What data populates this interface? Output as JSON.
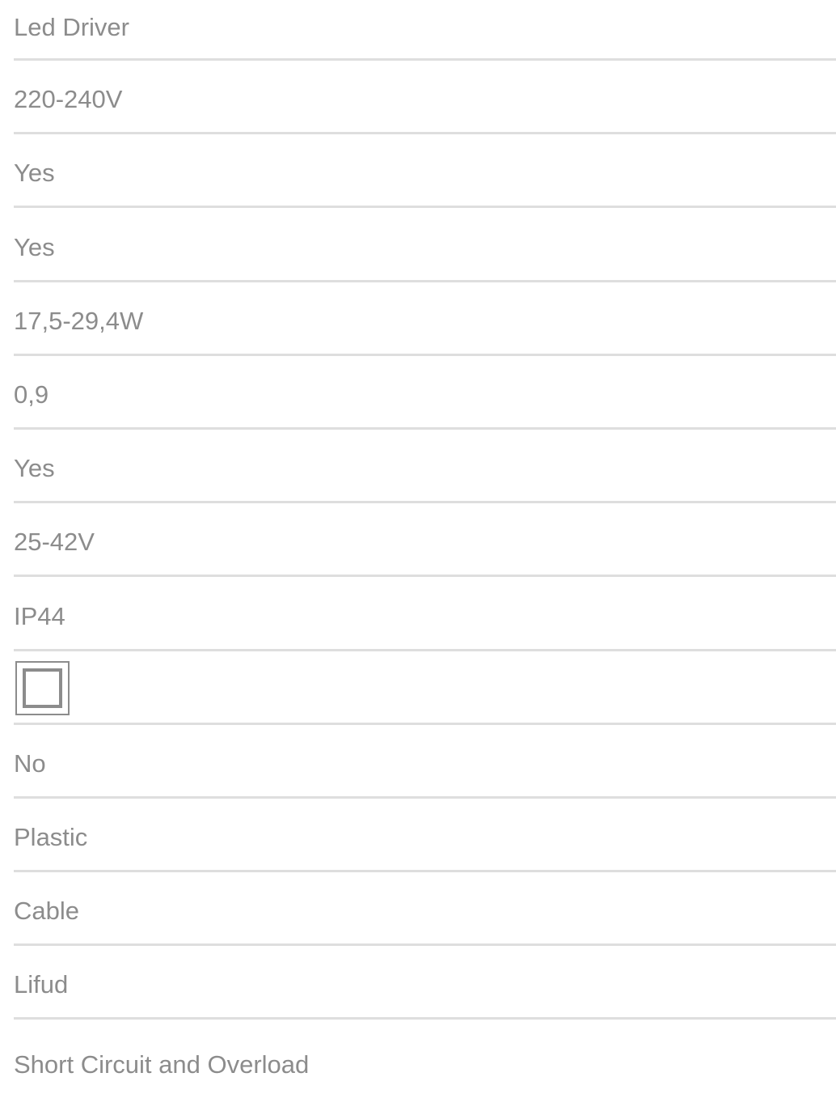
{
  "specs": [
    {
      "value": "Led Driver"
    },
    {
      "value": "220-240V"
    },
    {
      "value": "Yes"
    },
    {
      "value": "Yes"
    },
    {
      "value": "17,5-29,4W"
    },
    {
      "value": "0,9"
    },
    {
      "value": "Yes"
    },
    {
      "value": "25-42V"
    },
    {
      "value": "IP44"
    },
    {
      "icon": "class-ii-double-square-icon"
    },
    {
      "value": "No"
    },
    {
      "value": "Plastic"
    },
    {
      "value": "Cable"
    },
    {
      "value": "Lifud"
    },
    {
      "value": "Short Circuit and Overload"
    }
  ],
  "colors": {
    "text": "#8c8c8c",
    "divider": "#dedede",
    "icon_stroke": "#8c8c8c"
  }
}
